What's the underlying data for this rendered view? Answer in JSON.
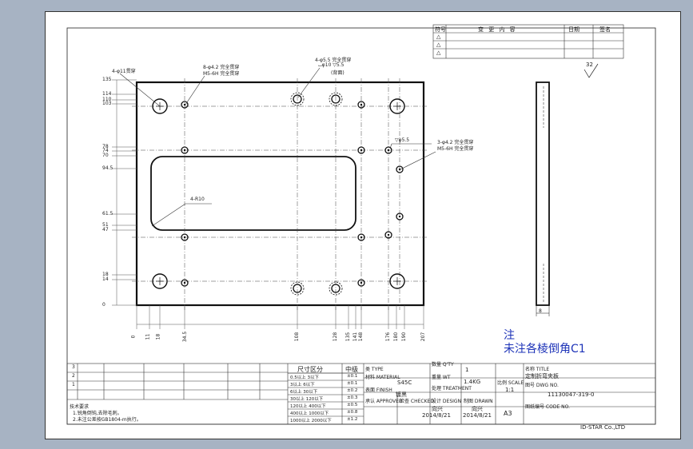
{
  "revision_table": {
    "col_mark": "符号",
    "col_content": "变 更 内 容",
    "col_date": "日期",
    "col_sign": "签名",
    "rows": [
      "△",
      "△",
      "△"
    ]
  },
  "roughness": "32",
  "notes": {
    "title": "注",
    "line": "未注各棱倒角C1"
  },
  "callouts": {
    "c1": "4-φ11贯穿",
    "c2a": "8-φ4.2 完全贯穿",
    "c2b": "M5-6H 完全贯穿",
    "c3a": "4-φ5.5 完全贯穿",
    "c3b": "⌴φ10 ▽5.5",
    "c3c": "(背面)",
    "c4a": "▽φ5.5",
    "c4b": "3-φ4.2 完全贯穿",
    "c4c": "M5-6H 完全贯穿",
    "c5": "4-R10"
  },
  "dims_left": [
    "135",
    "114",
    "110",
    "103",
    "78",
    "74",
    "70",
    "94.5",
    "61.5",
    "51",
    "47",
    "18",
    "14",
    "0"
  ],
  "dims_bottom": [
    "0",
    "11",
    "18",
    "34.5",
    "108",
    "128",
    "135",
    "141",
    "148",
    "176",
    "180",
    "190",
    "207"
  ],
  "side_dim": "8",
  "tech_req": {
    "title": "技术要求",
    "line1": "1.锐角倒钝,去除毛刺。",
    "line2": "2.未注公差按GB1804-m执行。"
  },
  "tolerance_table": {
    "header_size": "尺寸区分",
    "header_grade": "中级",
    "rows": [
      {
        "size": "0.5以上 3以下",
        "tol": "±0.1"
      },
      {
        "size": "3以上 6以下",
        "tol": "±0.1"
      },
      {
        "size": "6以上 30以下",
        "tol": "±0.2"
      },
      {
        "size": "30以上 120以下",
        "tol": "±0.3"
      },
      {
        "size": "120以上 400以下",
        "tol": "±0.5"
      },
      {
        "size": "400以上 1000以下",
        "tol": "±0.8"
      },
      {
        "size": "1000以上 2000以下",
        "tol": "±1.2"
      }
    ]
  },
  "title_block": {
    "type_label": "类 TYPE",
    "material_label": "材料 MATERIAL",
    "material_value": "S45C",
    "finish_label": "表面 FINISH",
    "finish_value": "镀黑",
    "qty_label": "数量 Q'TY",
    "qty_value": "1",
    "weight_label": "重量 WT",
    "weight_value": "1.4KG",
    "treatment_label": "处理 TREATMENT",
    "approved": "承认 APPROVED",
    "checked": "检查 CHECKED",
    "design_label": "设计 DESIGN",
    "design_name": "向兴",
    "design_date": "2014/8/21",
    "drawn_label": "制图 DRAWN",
    "drawn_name": "向兴",
    "drawn_date": "2014/8/21",
    "title_label": "名称 TITLE",
    "title_value": "定制折弯夹板",
    "scale_label": "比例 SCALE",
    "scale_value": "1:1",
    "dwg_label": "图号 DWG NO.",
    "dwg_value": "11130047-319-0",
    "size_value": "A3",
    "code_label": "图纸编号 CODE NO.",
    "company": "ID-STAR Co.,LTD"
  },
  "left_col_numbers": [
    "3",
    "2",
    "1"
  ]
}
